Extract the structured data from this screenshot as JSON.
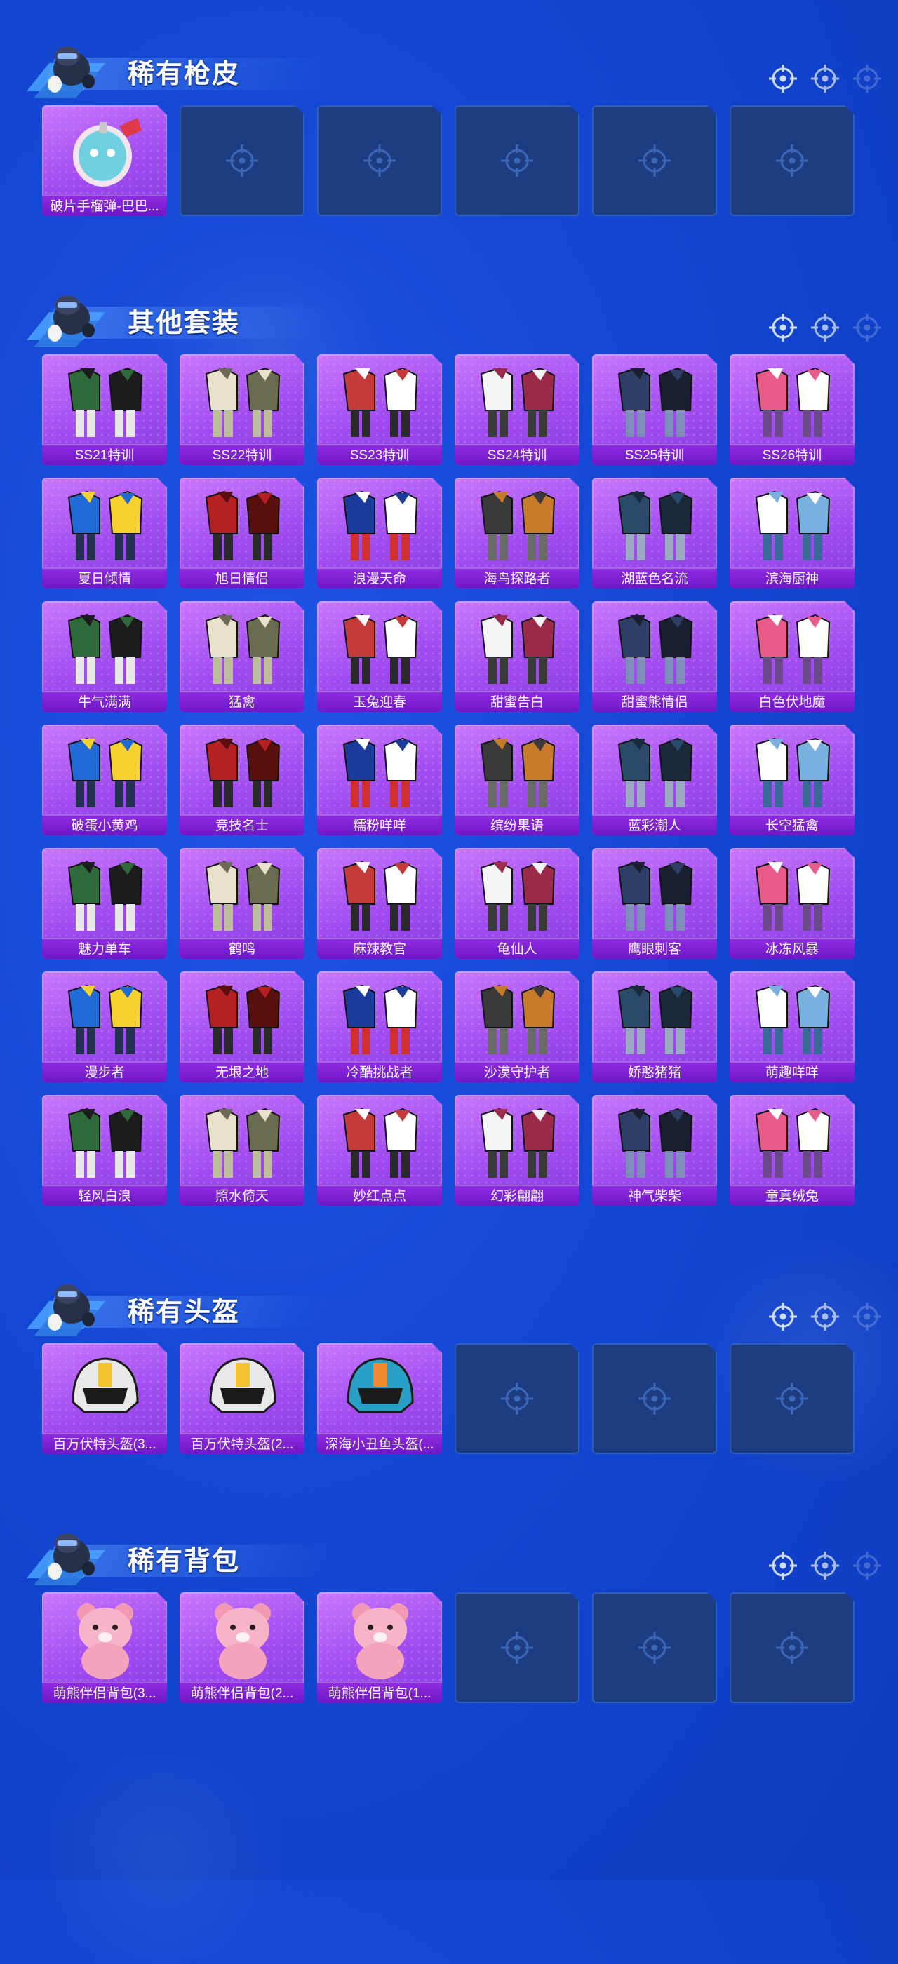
{
  "colors": {
    "background": "#1447d3",
    "card_purple": "#a14cf0",
    "label_purple": "#7a1fd0",
    "empty_card": "#1d3d80",
    "title_text": "#ffffff"
  },
  "sections": [
    {
      "title": "稀有枪皮",
      "items": [
        {
          "name": "破片手榴弹-巴巴...",
          "icon": "grenade-skin-icon"
        },
        {
          "name": "",
          "empty": true
        },
        {
          "name": "",
          "empty": true
        },
        {
          "name": "",
          "empty": true
        },
        {
          "name": "",
          "empty": true
        },
        {
          "name": "",
          "empty": true
        }
      ]
    },
    {
      "title": "其他套装",
      "items": [
        {
          "name": "SS21特训",
          "icon": "outfit-icon"
        },
        {
          "name": "SS22特训",
          "icon": "outfit-icon"
        },
        {
          "name": "SS23特训",
          "icon": "outfit-icon"
        },
        {
          "name": "SS24特训",
          "icon": "outfit-icon"
        },
        {
          "name": "SS25特训",
          "icon": "outfit-icon"
        },
        {
          "name": "SS26特训",
          "icon": "outfit-icon"
        },
        {
          "name": "夏日倾情",
          "icon": "outfit-icon"
        },
        {
          "name": "旭日情侣",
          "icon": "outfit-icon"
        },
        {
          "name": "浪漫天命",
          "icon": "outfit-icon"
        },
        {
          "name": "海鸟探路者",
          "icon": "outfit-icon"
        },
        {
          "name": "湖蓝色名流",
          "icon": "outfit-icon"
        },
        {
          "name": "滨海厨神",
          "icon": "outfit-icon"
        },
        {
          "name": "牛气满满",
          "icon": "outfit-icon"
        },
        {
          "name": "猛禽",
          "icon": "outfit-icon"
        },
        {
          "name": "玉兔迎春",
          "icon": "outfit-icon"
        },
        {
          "name": "甜蜜告白",
          "icon": "outfit-icon"
        },
        {
          "name": "甜蜜熊情侣",
          "icon": "outfit-icon"
        },
        {
          "name": "白色伏地魔",
          "icon": "outfit-icon"
        },
        {
          "name": "破蛋小黄鸡",
          "icon": "outfit-icon"
        },
        {
          "name": "竞技名士",
          "icon": "outfit-icon"
        },
        {
          "name": "糯粉咩咩",
          "icon": "outfit-icon"
        },
        {
          "name": "缤纷果语",
          "icon": "outfit-icon"
        },
        {
          "name": "蓝彩潮人",
          "icon": "outfit-icon"
        },
        {
          "name": "长空猛禽",
          "icon": "outfit-icon"
        },
        {
          "name": "魅力单车",
          "icon": "outfit-icon"
        },
        {
          "name": "鹤鸣",
          "icon": "outfit-icon"
        },
        {
          "name": "麻辣教官",
          "icon": "outfit-icon"
        },
        {
          "name": "龟仙人",
          "icon": "outfit-icon"
        },
        {
          "name": "鹰眼刺客",
          "icon": "outfit-icon"
        },
        {
          "name": "冰冻风暴",
          "icon": "outfit-icon"
        },
        {
          "name": "漫步者",
          "icon": "outfit-icon"
        },
        {
          "name": "无垠之地",
          "icon": "outfit-icon"
        },
        {
          "name": "冷酷挑战者",
          "icon": "outfit-icon"
        },
        {
          "name": "沙漠守护者",
          "icon": "outfit-icon"
        },
        {
          "name": "娇憨猪猪",
          "icon": "outfit-icon"
        },
        {
          "name": "萌趣咩咩",
          "icon": "outfit-icon"
        },
        {
          "name": "轻风白浪",
          "icon": "outfit-icon"
        },
        {
          "name": "照水倚天",
          "icon": "outfit-icon"
        },
        {
          "name": "妙红点点",
          "icon": "outfit-icon"
        },
        {
          "name": "幻彩翩翩",
          "icon": "outfit-icon"
        },
        {
          "name": "神气柴柴",
          "icon": "outfit-icon"
        },
        {
          "name": "童真绒兔",
          "icon": "outfit-icon"
        }
      ]
    },
    {
      "title": "稀有头盔",
      "items": [
        {
          "name": "百万伏特头盔(3...",
          "icon": "helmet-icon"
        },
        {
          "name": "百万伏特头盔(2...",
          "icon": "helmet-icon"
        },
        {
          "name": "深海小丑鱼头盔(...",
          "icon": "helmet-icon"
        },
        {
          "name": "",
          "empty": true
        },
        {
          "name": "",
          "empty": true
        },
        {
          "name": "",
          "empty": true
        }
      ]
    },
    {
      "title": "稀有背包",
      "items": [
        {
          "name": "萌熊伴侣背包(3...",
          "icon": "backpack-icon"
        },
        {
          "name": "萌熊伴侣背包(2...",
          "icon": "backpack-icon"
        },
        {
          "name": "萌熊伴侣背包(1...",
          "icon": "backpack-icon"
        },
        {
          "name": "",
          "empty": true
        },
        {
          "name": "",
          "empty": true
        },
        {
          "name": "",
          "empty": true
        }
      ]
    }
  ]
}
